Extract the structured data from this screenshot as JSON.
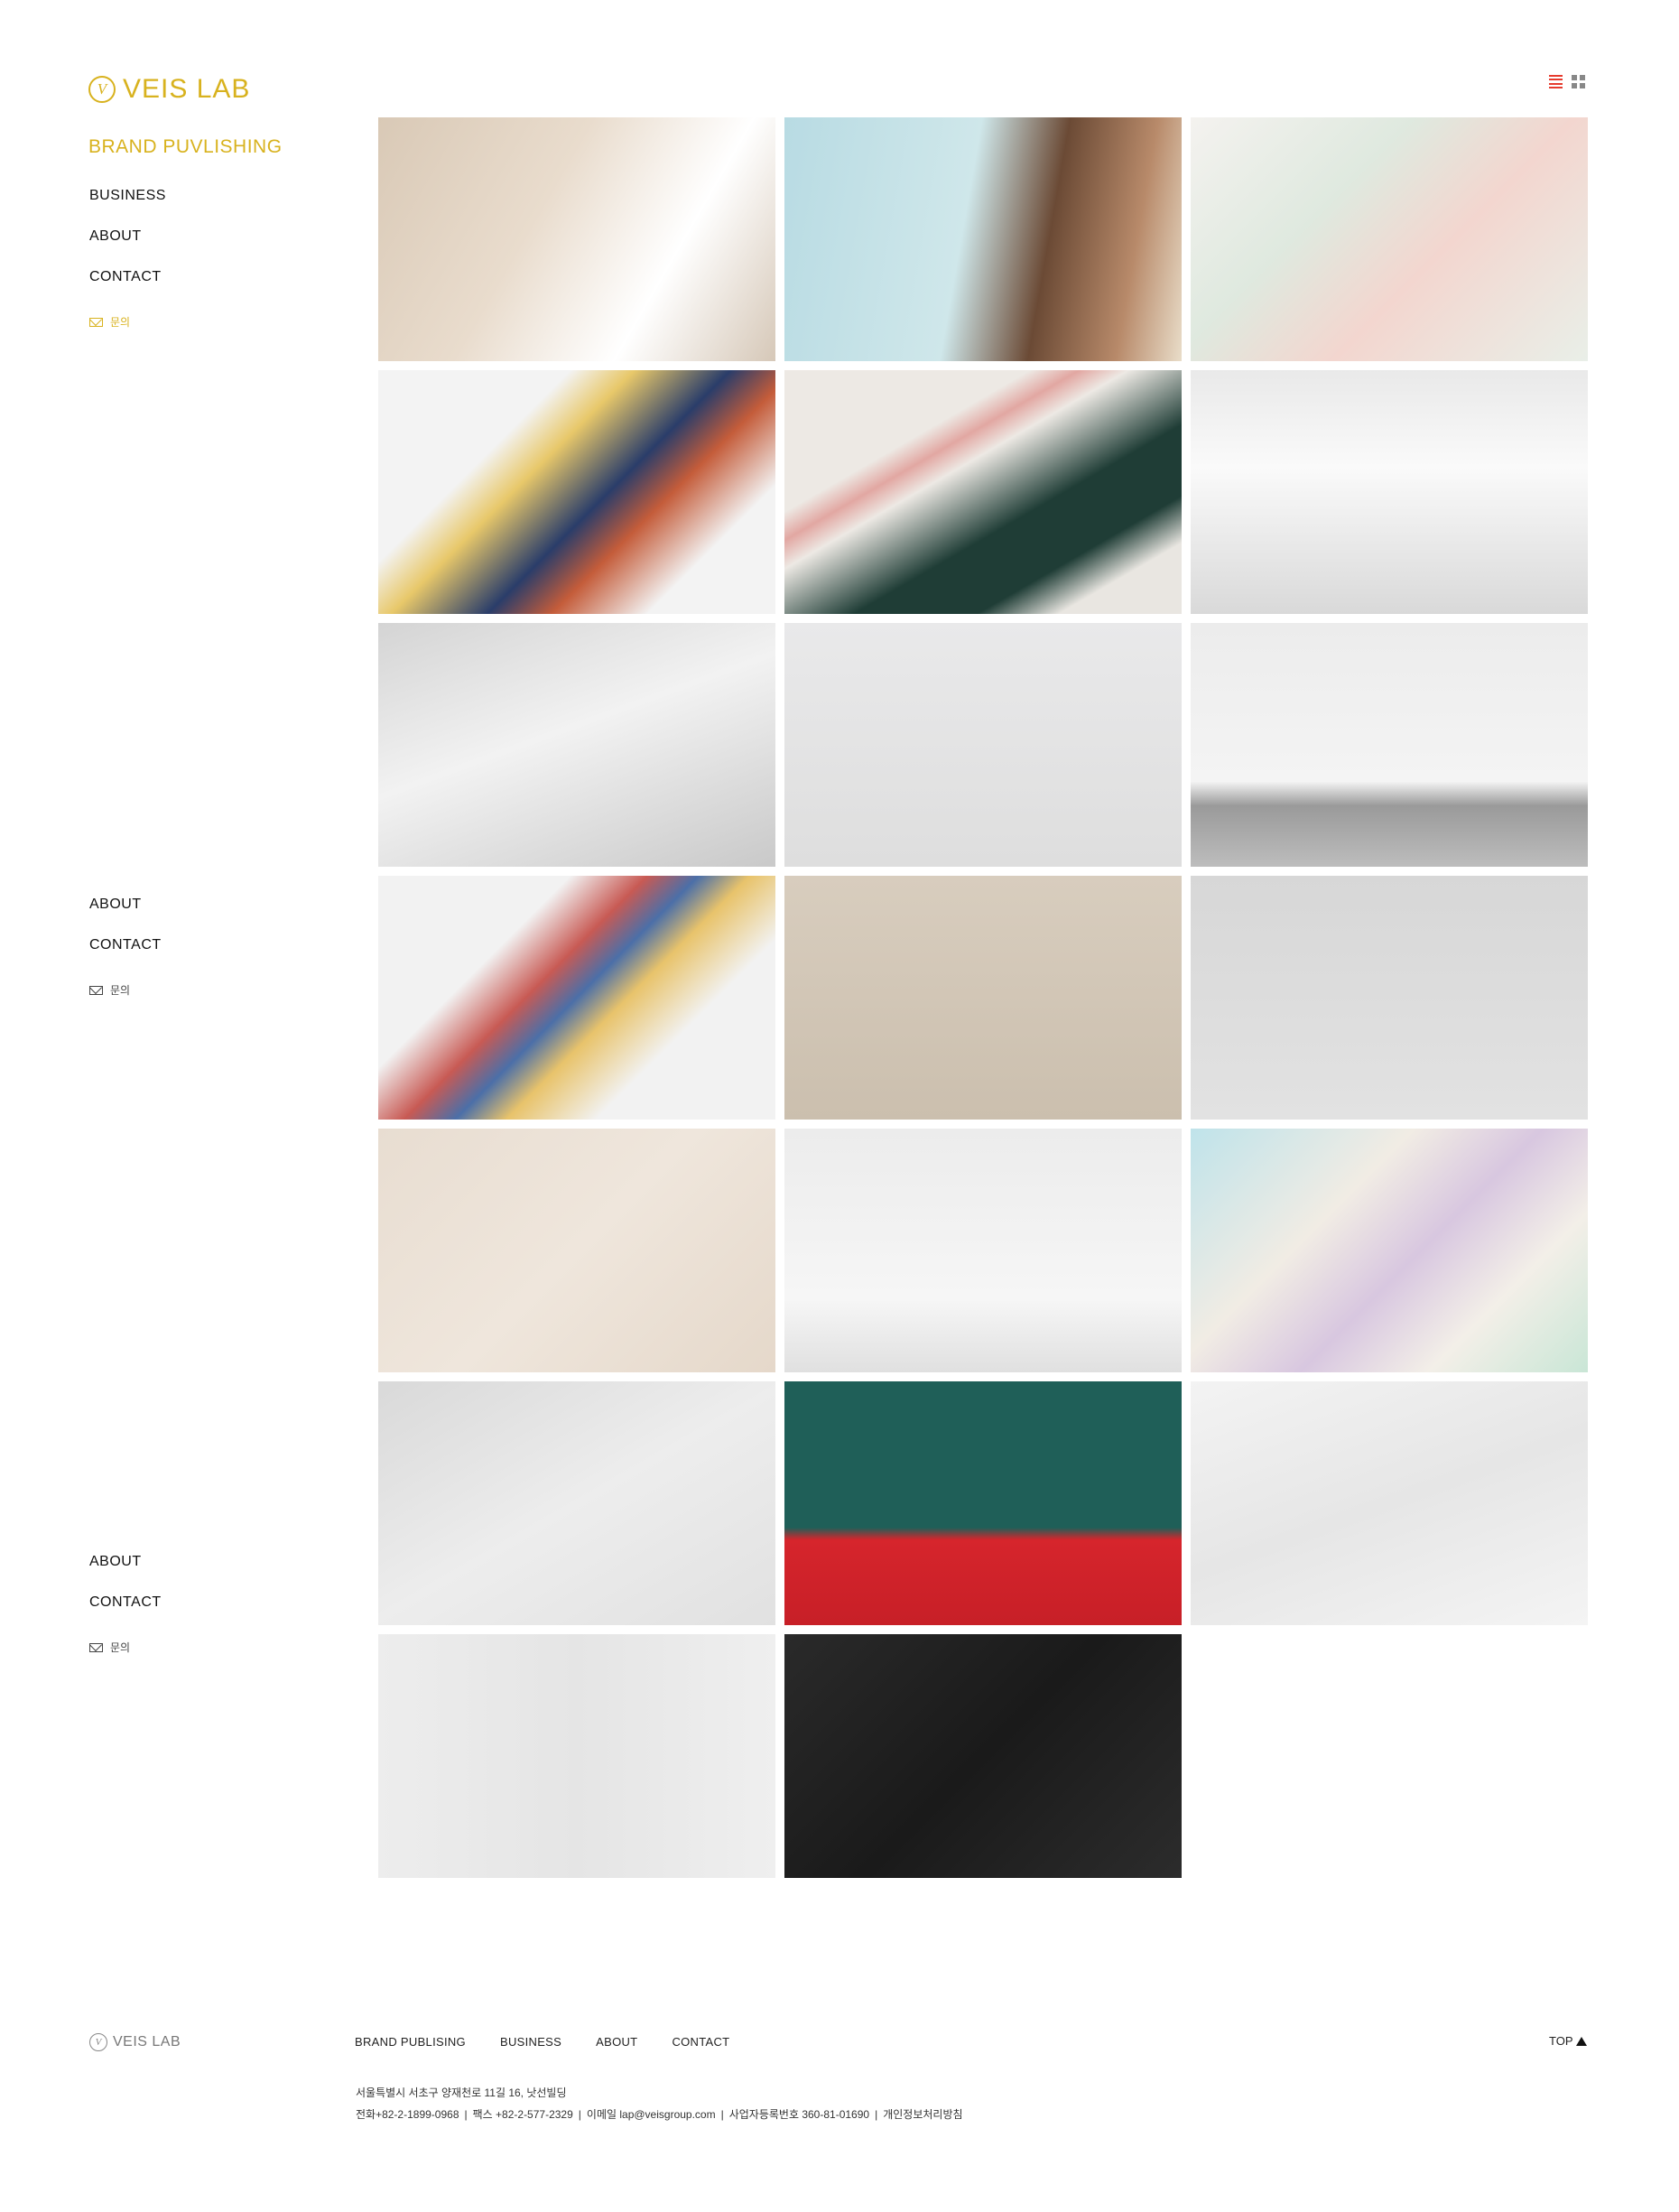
{
  "brand": {
    "logo_mark": "V",
    "logo_text": "VEIS LAB",
    "color": "#d8b21e"
  },
  "sidebar": {
    "active": "BRAND PUVLISHING",
    "nav": [
      "BUSINESS",
      "ABOUT",
      "CONTACT"
    ],
    "inquiry": "문의"
  },
  "sidebar_repeat": {
    "nav": [
      "ABOUT",
      "CONTACT"
    ],
    "inquiry": "문의"
  },
  "view_toggle": {
    "list_icon": "list-view-icon",
    "grid_icon": "grid-view-icon",
    "active_color": "#e63b2e"
  },
  "gallery": {
    "tiles": [
      {
        "name": "tile-verite-tubes",
        "bg": "linear-gradient(120deg,#d9c9b6 0%,#e9dccd 40%,#ffffff 70%,#d6c8b8 100%)"
      },
      {
        "name": "tile-portrait",
        "bg": "linear-gradient(100deg,#b8dbe3 0%,#cfe7ea 45%,#6b4a35 65%,#b88a6a 85%,#e9ddc9 100%)"
      },
      {
        "name": "tile-pastel-boxes",
        "bg": "linear-gradient(135deg,#f4f2ef 0%,#dfe9df 35%,#f3d6cf 60%,#e9efe8 100%)"
      },
      {
        "name": "tile-landscape-cubes",
        "bg": "linear-gradient(135deg,#f3f3f3 30%,#e8c86a 40%,#2a3d6a 55%,#c45c3a 65%,#f3f3f3 80%)"
      },
      {
        "name": "tile-dark-card",
        "bg": "linear-gradient(150deg,#ede9e4 30%,#e2a7a2 36%,#ede9e4 42%,#1f3d36 60%,#1f3d36 75%,#e9e6e1 85%)"
      },
      {
        "name": "tile-cream-tubes",
        "bg": "linear-gradient(180deg,#e9e9e9 0%,#fafafa 40%,#d9d9d9 100%)"
      },
      {
        "name": "tile-white-boxes",
        "bg": "linear-gradient(160deg,#d4d4d4 0%,#f2f2f2 45%,#c9c9c9 100%)"
      },
      {
        "name": "tile-eau-bottles",
        "bg": "linear-gradient(180deg,#e9e9ea 0%,#dedede 100%)"
      },
      {
        "name": "tile-gift-box",
        "bg": "linear-gradient(180deg,#ececec 0%,#f4f4f4 65%,#9a9a9a 75%,#bdbdbd 100%)"
      },
      {
        "name": "tile-pattern-cubes",
        "bg": "linear-gradient(135deg,#f2f2f2 30%,#c85a54 42%,#4b6fa8 50%,#e8c36b 58%,#f2f2f2 72%)"
      },
      {
        "name": "tile-beige-tube",
        "bg": "linear-gradient(180deg,#d8cdbe 0%,#cbbfae 100%)"
      },
      {
        "name": "tile-silver-box",
        "bg": "linear-gradient(180deg,#d7d7d7 0%,#e2e2e2 100%)"
      },
      {
        "name": "tile-camellia-line",
        "bg": "linear-gradient(135deg,#e8ddd1 0%,#efe6dc 50%,#e5d8ca 100%)"
      },
      {
        "name": "tile-teal-boxes",
        "bg": "linear-gradient(180deg,#ececec 0%,#f6f6f6 70%,#e0e0e0 100%)"
      },
      {
        "name": "tile-holo-boxes",
        "bg": "linear-gradient(135deg,#bfe3ea 0%,#f1ece4 35%,#d8c7e0 55%,#f3efe8 75%,#c9e6d6 100%)"
      },
      {
        "name": "tile-git-gud",
        "bg": "linear-gradient(150deg,#d9d9d9 0%,#ededed 50%,#e1e1e1 100%)"
      },
      {
        "name": "tile-red-cans",
        "bg": "linear-gradient(180deg,#1f5f58 0%,#1f5f58 60%,#d6252c 65%,#c71f27 100%)"
      },
      {
        "name": "tile-gold-boxes",
        "bg": "linear-gradient(160deg,#f3f3f3 0%,#e6e6e6 50%,#f4f4f4 100%)"
      },
      {
        "name": "tile-drg-tubes",
        "bg": "linear-gradient(90deg,#ededed 0%,#e5e5e5 50%,#efefef 100%)"
      },
      {
        "name": "tile-black-boxes",
        "bg": "linear-gradient(135deg,#2a2a2a 0%,#1a1a1a 50%,#2c2c2c 100%)"
      }
    ]
  },
  "footer": {
    "logo_text": "VEIS LAB",
    "nav": [
      "BRAND PUBLISING",
      "BUSINESS",
      "ABOUT",
      "CONTACT"
    ],
    "top_label": "TOP",
    "address": "서울특별시 서초구 양재천로 11길 16, 낫선빌딩",
    "tel": "전화+82-2-1899-0968",
    "fax": "팩스 +82-2-577-2329",
    "email": "이메일 lap@veisgroup.com",
    "biz_no": "사업자등록번호 360-81-01690",
    "privacy": "개인정보처리방침"
  }
}
